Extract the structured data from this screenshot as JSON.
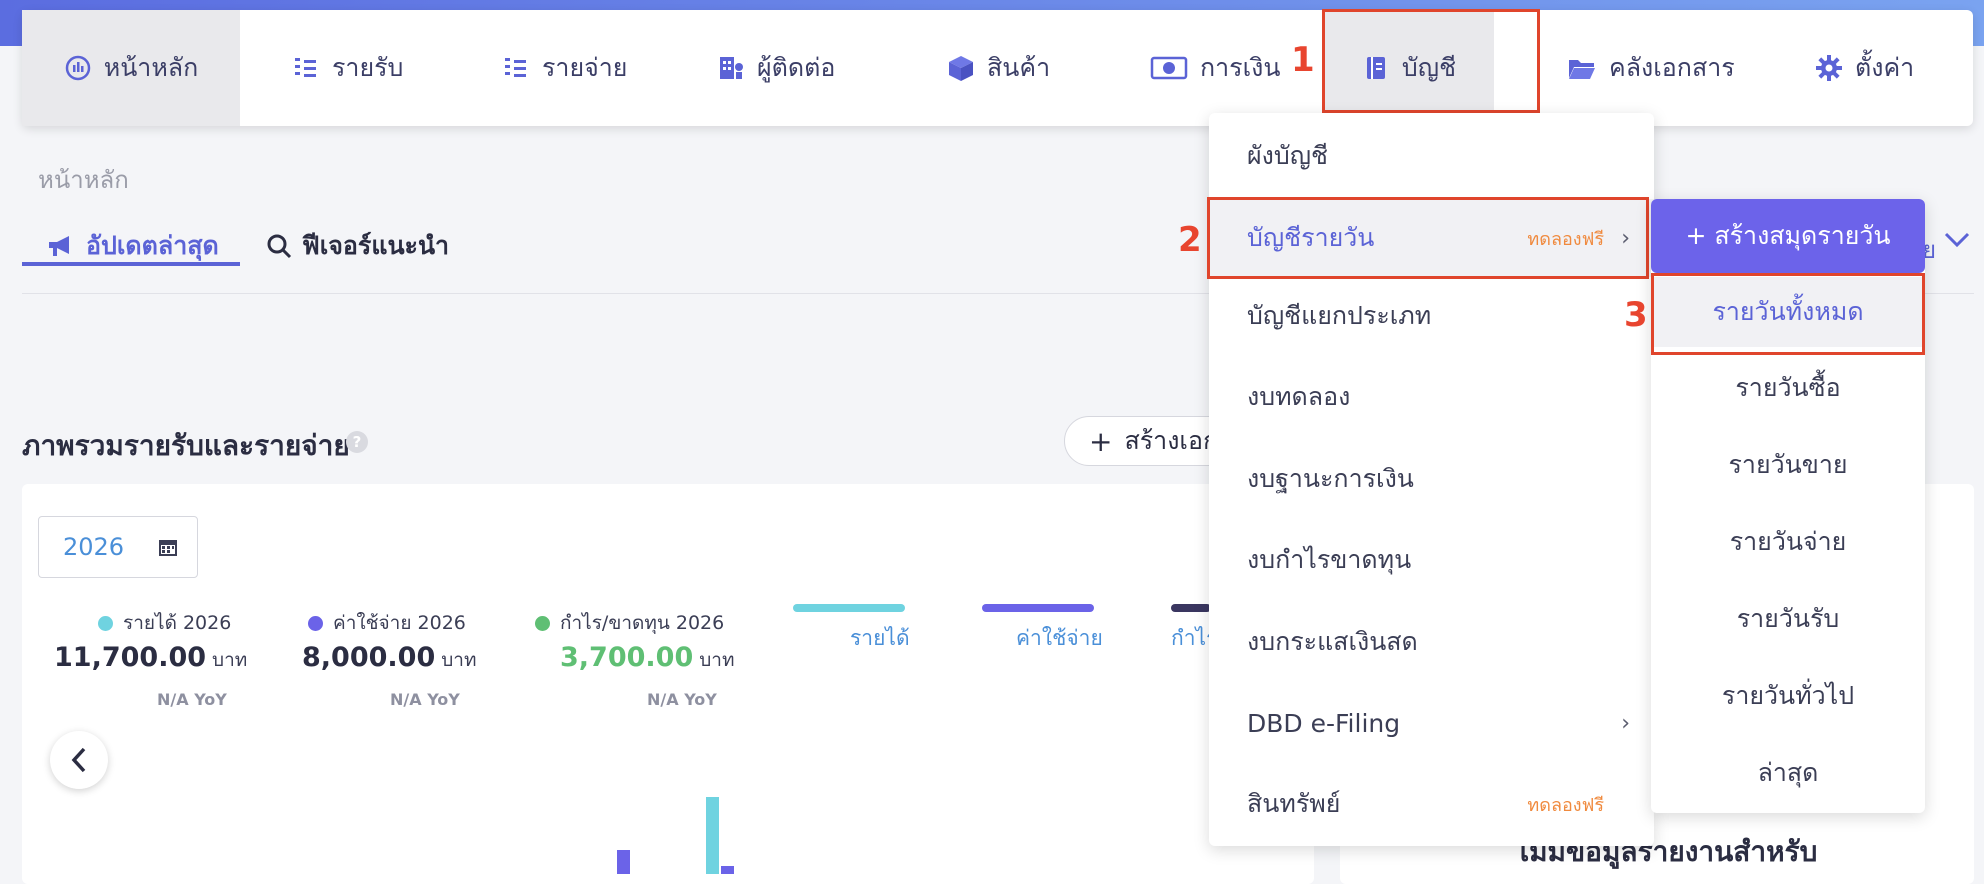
{
  "nav": {
    "items": [
      {
        "label": "หน้าหลัก",
        "icon": "dashboard-icon"
      },
      {
        "label": "รายรับ",
        "icon": "income-icon"
      },
      {
        "label": "รายจ่าย",
        "icon": "expense-icon"
      },
      {
        "label": "ผู้ติดต่อ",
        "icon": "contacts-icon"
      },
      {
        "label": "สินค้า",
        "icon": "box-icon"
      },
      {
        "label": "การเงิน",
        "icon": "money-icon"
      },
      {
        "label": "บัญชี",
        "icon": "ledger-icon"
      },
      {
        "label": "คลังเอกสาร",
        "icon": "folder-icon"
      },
      {
        "label": "ตั้งค่า",
        "icon": "gear-icon"
      }
    ]
  },
  "annotations": [
    "1",
    "2",
    "3"
  ],
  "breadcrumb": "หน้าหลัก",
  "tabs": [
    {
      "label": "อัปเดตล่าสุด",
      "icon": "megaphone-icon"
    },
    {
      "label": "ฟีเจอร์แนะนำ",
      "icon": "search-icon"
    }
  ],
  "right_peek": "ย",
  "section": {
    "title": "ภาพรวมรายรับและรายจ่าย",
    "help": "?",
    "create_button": "สร้างเอกสาร"
  },
  "summary": {
    "year": "2026",
    "kpis": [
      {
        "label": "รายได้ 2026",
        "value": "11,700.00",
        "unit": "บาท",
        "yoy": "N/A YoY",
        "color": "#6fd3e0"
      },
      {
        "label": "ค่าใช้จ่าย 2026",
        "value": "8,000.00",
        "unit": "บาท",
        "yoy": "N/A YoY",
        "color": "#6b63e8"
      },
      {
        "label": "กำไร/ขาดทุน 2026",
        "value": "3,700.00",
        "unit": "บาท",
        "yoy": "N/A YoY",
        "color": "#5fbf74"
      }
    ],
    "legend": [
      "รายได้",
      "ค่าใช้จ่าย",
      "กำไร"
    ]
  },
  "right_card_text": "ไม่มีข้อมูลรายงานสำหรับ",
  "account_menu": {
    "items": [
      {
        "label": "ผังบัญชี",
        "badge": ""
      },
      {
        "label": "บัญชีรายวัน",
        "badge": "ทดลองฟรี",
        "chevron": "›"
      },
      {
        "label": "บัญชีแยกประเภท",
        "badge": ""
      },
      {
        "label": "งบทดลอง",
        "badge": ""
      },
      {
        "label": "งบฐานะการเงิน",
        "badge": ""
      },
      {
        "label": "งบกำไรขาดทุน",
        "badge": ""
      },
      {
        "label": "งบกระแสเงินสด",
        "badge": ""
      },
      {
        "label": "DBD e-Filing",
        "badge": "",
        "chevron": "›"
      },
      {
        "label": "สินทรัพย์",
        "badge": "ทดลองฟรี"
      }
    ]
  },
  "journal_submenu": {
    "create_label": "+ สร้างสมุดรายวัน",
    "items": [
      "รายวันทั้งหมด",
      "รายวันซื้อ",
      "รายวันขาย",
      "รายวันจ่าย",
      "รายวันรับ",
      "รายวันทั่วไป",
      "ล่าสุด"
    ]
  },
  "colors": {
    "accent": "#5b63d6",
    "annotation": "#e8452f",
    "badge": "#f08a3e"
  }
}
